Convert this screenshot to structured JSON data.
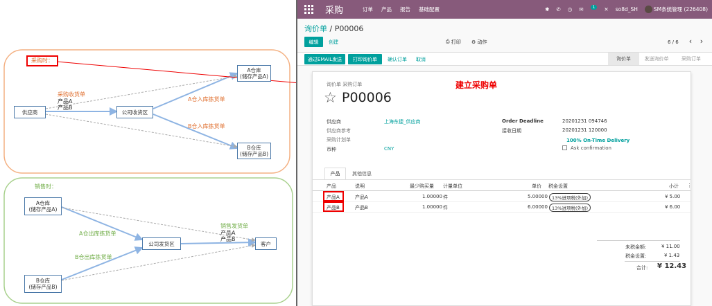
{
  "left": {
    "purchase": {
      "trigger": "采购时：",
      "receipt_label": "采购收货单",
      "product_a": "产品A",
      "product_b": "产品B",
      "supplier": "供应商",
      "receiving_area": "公司收货区",
      "a_inbound": "A仓入库拣货单",
      "b_inbound": "B仓入库拣货单",
      "warehouse_a_line1": "A仓库",
      "warehouse_a_line2": "(储存产品A)",
      "warehouse_b_line1": "B仓库",
      "warehouse_b_line2": "(储存产品B)"
    },
    "sales": {
      "trigger": "销售时：",
      "warehouse_a_line1": "A仓库",
      "warehouse_a_line2": "(储存产品A)",
      "warehouse_b_line1": "B仓库",
      "warehouse_b_line2": "(储存产品B)",
      "a_outbound": "A仓出库拣货单",
      "b_outbound": "B仓出库拣货单",
      "shipping_area": "公司发货区",
      "delivery_label": "销售发货单",
      "product_a": "产品A",
      "product_b": "产品B",
      "customer": "客户"
    },
    "callout": "建立采购单",
    "colors": {
      "purchase_border": "#f4b183",
      "sales_border": "#a9d18e",
      "arrow": "#8eb4e3",
      "red": "#e00000"
    }
  },
  "topbar": {
    "app_title": "采购",
    "menu": [
      "订单",
      "产品",
      "报告",
      "基础配置"
    ],
    "chat_count": "1",
    "company": "so8d_SH",
    "user": "SM条统管理 (226408)",
    "color": "#875a7b"
  },
  "breadcrumb": {
    "parent": "询价单",
    "separator": " / ",
    "current": "P00006"
  },
  "toolbar": {
    "edit": "编辑",
    "create": "创建",
    "print": "打印",
    "action": "动作",
    "pager": "6 / 6"
  },
  "statusbar": {
    "buttons": [
      "通过EMAIL发送",
      "打印询价单",
      "确认订单",
      "取消"
    ],
    "stages": [
      "询价单",
      "发送询价单",
      "采购订单"
    ],
    "active_stage": "询价单"
  },
  "form": {
    "doc_type": "询价单 采购订单",
    "name": "P00006",
    "vendor_label": "供应商",
    "vendor": "上海东捷_供应商",
    "vendor_ref_label": "供应商参考",
    "requisition_label": "采购计划单",
    "currency_label": "币种",
    "currency": "CNY",
    "deadline_label": "Order Deadline",
    "deadline": "20201231 094746",
    "receipt_date_label": "接收日期",
    "receipt_date": "20201231 120000",
    "on_time": "100% On-Time Delivery",
    "ask_confirm": "Ask confirmation",
    "tabs": [
      "产品",
      "其他信息"
    ],
    "columns": [
      "产品",
      "说明",
      "最少购买量",
      "计量单位",
      "单价",
      "税金设置",
      "小计"
    ],
    "lines": [
      {
        "product": "产品A",
        "desc": "产品A",
        "qty": "1.00000",
        "uom": "件",
        "price": "5.00000",
        "tax": "13%进项税(外加)",
        "subtotal": "¥ 5.00"
      },
      {
        "product": "产品B",
        "desc": "产品B",
        "qty": "1.00000",
        "uom": "件",
        "price": "6.00000",
        "tax": "13%进项税(外加)",
        "subtotal": "¥ 6.00"
      }
    ],
    "untaxed_label": "未税金额:",
    "untaxed": "¥ 11.00",
    "tax_label": "税金设置:",
    "tax": "¥ 1.43",
    "total_label": "合计:",
    "total": "¥ 12.43"
  }
}
